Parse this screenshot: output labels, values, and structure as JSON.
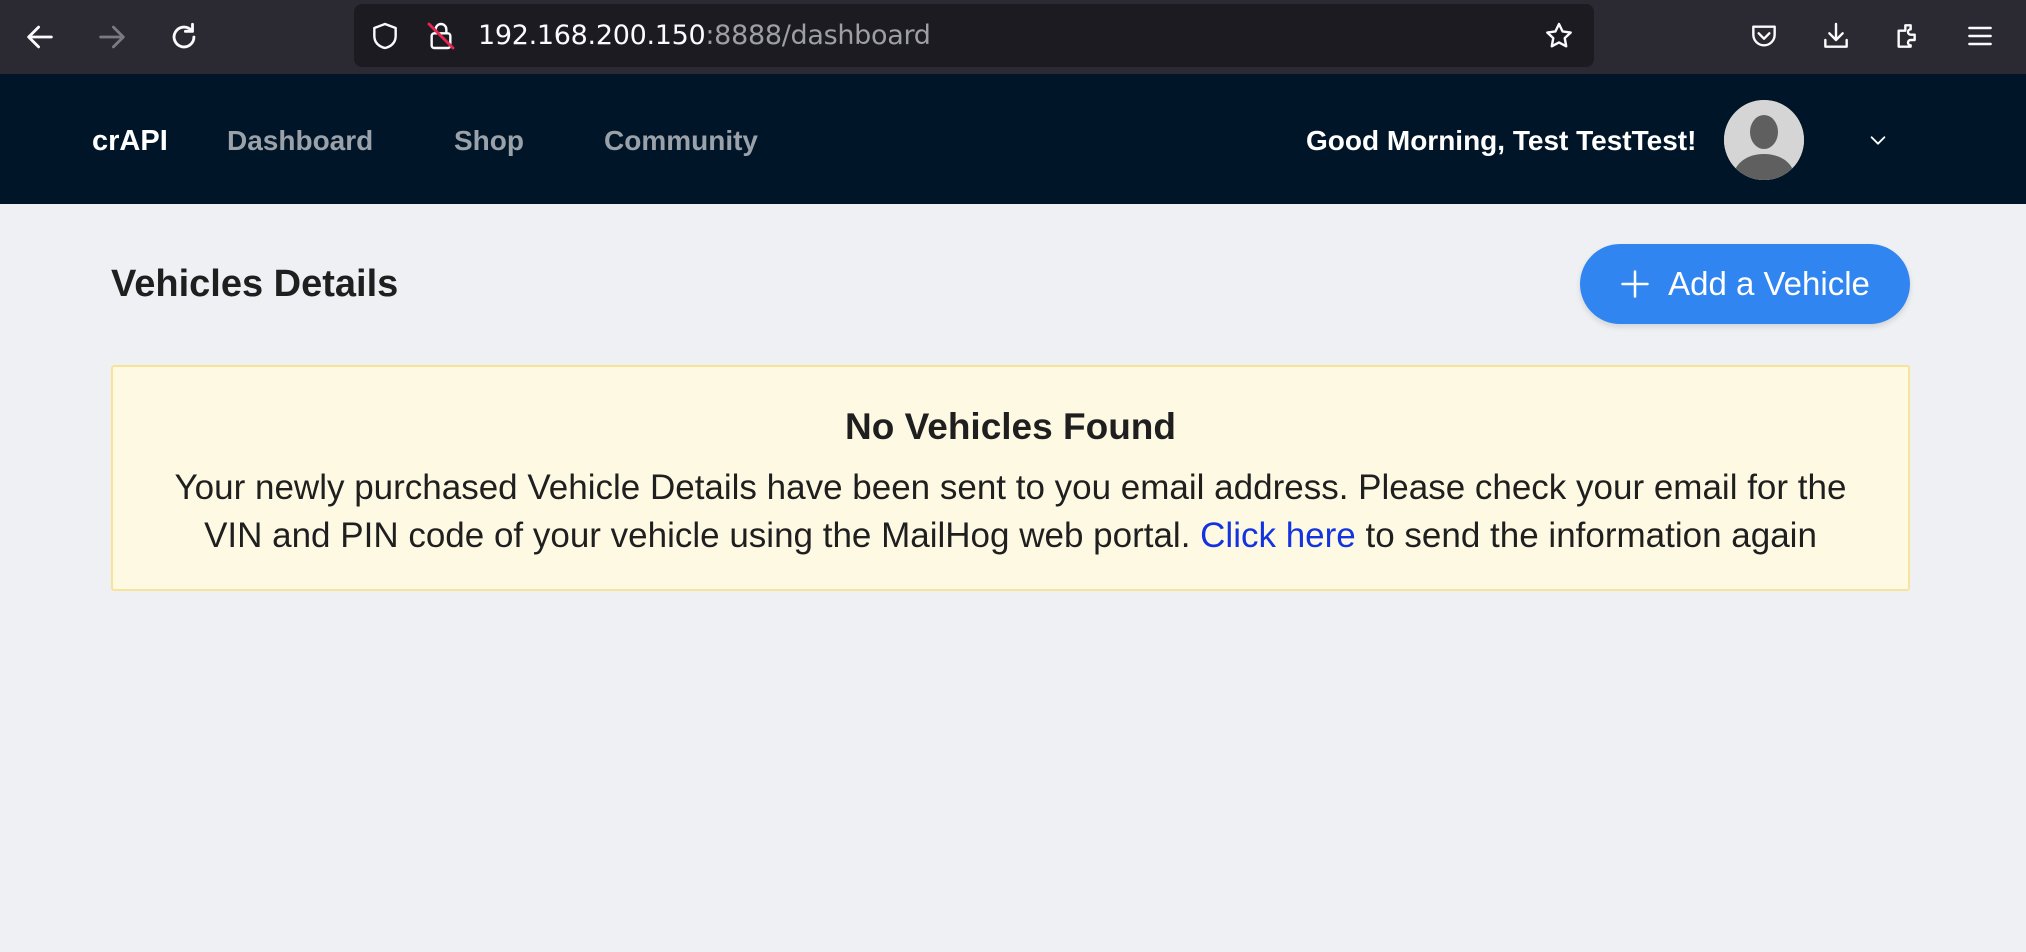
{
  "browser": {
    "url_host": "192.168.200.150",
    "url_path": ":8888/dashboard",
    "icons": [
      "back-arrow-icon",
      "forward-arrow-icon",
      "reload-icon",
      "shield-icon",
      "insecure-lock-icon",
      "star-bookmark-icon",
      "pocket-icon",
      "download-icon",
      "extensions-icon",
      "hamburger-menu-icon"
    ],
    "colors": {
      "chrome_bg": "#2b2a33",
      "urlbar_bg": "#1c1b22"
    }
  },
  "navbar": {
    "brand": "crAPI",
    "links": [
      {
        "label": "Dashboard"
      },
      {
        "label": "Shop"
      },
      {
        "label": "Community"
      }
    ],
    "greeting": "Good Morning, Test TestTest!",
    "colors": {
      "bg": "#001528",
      "link": "#9aa1a9"
    }
  },
  "main": {
    "title": "Vehicles Details",
    "add_button_label": "Add a Vehicle",
    "alert": {
      "title": "No Vehicles Found",
      "text_before_line": "Your newly purchased Vehicle Details have been sent to you email address. Please check your email for the",
      "text_line2_before_link": "VIN and PIN code of your vehicle using the MailHog web portal.",
      "link_text": "Click here",
      "text_after_link": "to send the information again"
    },
    "colors": {
      "accent": "#3085f1",
      "alert_bg": "#fdf9e3",
      "alert_border": "#f8e39a",
      "link": "#1433e0"
    }
  }
}
